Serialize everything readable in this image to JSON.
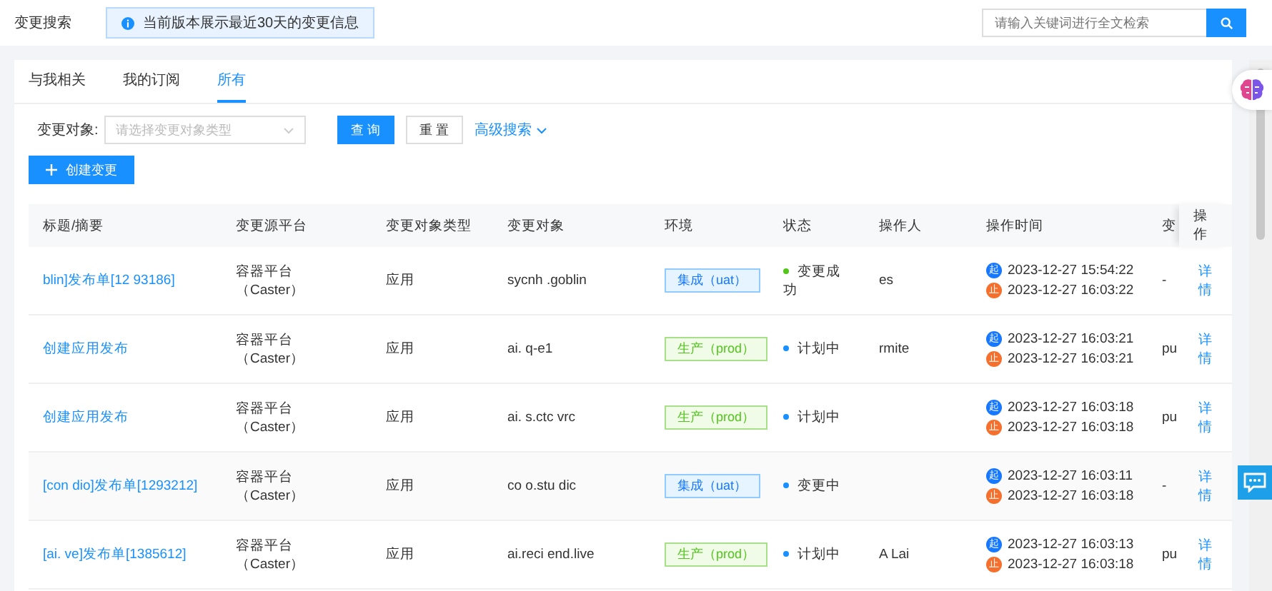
{
  "header": {
    "title": "变更搜索",
    "notice": "当前版本展示最近30天的变更信息",
    "search": {
      "placeholder": "请输入关键词进行全文检索"
    }
  },
  "tabs": [
    {
      "label": "与我相关",
      "selected": false
    },
    {
      "label": "我的订阅",
      "selected": false
    },
    {
      "label": "所有",
      "selected": true
    }
  ],
  "filter": {
    "label": "变更对象:",
    "placeholder": "请选择变更对象类型",
    "query_button": "查 询",
    "reset_button": "重 置",
    "advanced_link": "高级搜索"
  },
  "create_button": "创建变更",
  "table": {
    "columns": [
      "标题/摘要",
      "变更源平台",
      "变更对象类型",
      "变更对象",
      "环境",
      "状态",
      "操作人",
      "操作时间",
      "变",
      "操作"
    ],
    "rows": [
      {
        "title": "blin]发布单[12 93186]",
        "platform": "容器平台（Caster）",
        "object_type": "应用",
        "object": "sycnh .goblin",
        "env": {
          "label": "集成（uat）",
          "kind": "uat"
        },
        "status": {
          "label": "变更成功",
          "color": "#52c41a"
        },
        "operator": "es",
        "start_mark": "起",
        "start": "2023-12-27 15:54:22",
        "end_mark": "止",
        "end": "2023-12-27 16:03:22",
        "column_9": "-",
        "action": "详情"
      },
      {
        "title": "创建应用发布",
        "platform": "容器平台（Caster）",
        "object_type": "应用",
        "object": "ai. q-e1",
        "env": {
          "label": "生产（prod）",
          "kind": "prod"
        },
        "status": {
          "label": "计划中",
          "color": "#1890ff"
        },
        "operator": "rmite",
        "start_mark": "起",
        "start": "2023-12-27 16:03:21",
        "end_mark": "止",
        "end": "2023-12-27 16:03:21",
        "column_9": "pu",
        "action": "详情"
      },
      {
        "title": "创建应用发布",
        "platform": "容器平台（Caster）",
        "object_type": "应用",
        "object": "ai. s.ctc vrc",
        "env": {
          "label": "生产（prod）",
          "kind": "prod"
        },
        "status": {
          "label": "计划中",
          "color": "#1890ff"
        },
        "start_mark": "起",
        "start": "2023-12-27 16:03:18",
        "end_mark": "止",
        "end": "2023-12-27 16:03:18",
        "column_9": "pu",
        "action": "详情"
      },
      {
        "title": "[con dio]发布单[1293212]",
        "platform": "容器平台（Caster）",
        "object_type": "应用",
        "object": "co o.stu dic",
        "env": {
          "label": "集成（uat）",
          "kind": "uat"
        },
        "status": {
          "label": "变更中",
          "color": "#1890ff"
        },
        "start_mark": "起",
        "start": "2023-12-27 16:03:11",
        "end_mark": "止",
        "end": "2023-12-27 16:03:18",
        "column_9": "-",
        "action": "详情"
      },
      {
        "title": "[ai. ve]发布单[1385612]",
        "platform": "容器平台（Caster）",
        "object_type": "应用",
        "object": "ai.reci end.live",
        "env": {
          "label": "生产（prod）",
          "kind": "prod"
        },
        "status": {
          "label": "计划中",
          "color": "#1890ff"
        },
        "operator": "A Lai",
        "start_mark": "起",
        "start": "2023-12-27 16:03:13",
        "end_mark": "止",
        "end": "2023-12-27 16:03:18",
        "column_9": "pu",
        "action": "详情"
      }
    ]
  }
}
